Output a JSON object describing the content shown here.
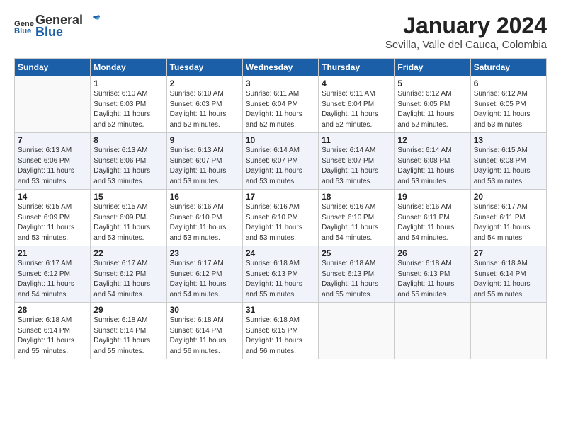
{
  "logo": {
    "general": "General",
    "blue": "Blue"
  },
  "title": "January 2024",
  "location": "Sevilla, Valle del Cauca, Colombia",
  "headers": [
    "Sunday",
    "Monday",
    "Tuesday",
    "Wednesday",
    "Thursday",
    "Friday",
    "Saturday"
  ],
  "weeks": [
    [
      {
        "day": "",
        "sunrise": "",
        "sunset": "",
        "daylight": ""
      },
      {
        "day": "1",
        "sunrise": "6:10 AM",
        "sunset": "6:03 PM",
        "daylight": "11 hours and 52 minutes."
      },
      {
        "day": "2",
        "sunrise": "6:10 AM",
        "sunset": "6:03 PM",
        "daylight": "11 hours and 52 minutes."
      },
      {
        "day": "3",
        "sunrise": "6:11 AM",
        "sunset": "6:04 PM",
        "daylight": "11 hours and 52 minutes."
      },
      {
        "day": "4",
        "sunrise": "6:11 AM",
        "sunset": "6:04 PM",
        "daylight": "11 hours and 52 minutes."
      },
      {
        "day": "5",
        "sunrise": "6:12 AM",
        "sunset": "6:05 PM",
        "daylight": "11 hours and 52 minutes."
      },
      {
        "day": "6",
        "sunrise": "6:12 AM",
        "sunset": "6:05 PM",
        "daylight": "11 hours and 53 minutes."
      }
    ],
    [
      {
        "day": "7",
        "sunrise": "6:13 AM",
        "sunset": "6:06 PM",
        "daylight": "11 hours and 53 minutes."
      },
      {
        "day": "8",
        "sunrise": "6:13 AM",
        "sunset": "6:06 PM",
        "daylight": "11 hours and 53 minutes."
      },
      {
        "day": "9",
        "sunrise": "6:13 AM",
        "sunset": "6:07 PM",
        "daylight": "11 hours and 53 minutes."
      },
      {
        "day": "10",
        "sunrise": "6:14 AM",
        "sunset": "6:07 PM",
        "daylight": "11 hours and 53 minutes."
      },
      {
        "day": "11",
        "sunrise": "6:14 AM",
        "sunset": "6:07 PM",
        "daylight": "11 hours and 53 minutes."
      },
      {
        "day": "12",
        "sunrise": "6:14 AM",
        "sunset": "6:08 PM",
        "daylight": "11 hours and 53 minutes."
      },
      {
        "day": "13",
        "sunrise": "6:15 AM",
        "sunset": "6:08 PM",
        "daylight": "11 hours and 53 minutes."
      }
    ],
    [
      {
        "day": "14",
        "sunrise": "6:15 AM",
        "sunset": "6:09 PM",
        "daylight": "11 hours and 53 minutes."
      },
      {
        "day": "15",
        "sunrise": "6:15 AM",
        "sunset": "6:09 PM",
        "daylight": "11 hours and 53 minutes."
      },
      {
        "day": "16",
        "sunrise": "6:16 AM",
        "sunset": "6:10 PM",
        "daylight": "11 hours and 53 minutes."
      },
      {
        "day": "17",
        "sunrise": "6:16 AM",
        "sunset": "6:10 PM",
        "daylight": "11 hours and 53 minutes."
      },
      {
        "day": "18",
        "sunrise": "6:16 AM",
        "sunset": "6:10 PM",
        "daylight": "11 hours and 54 minutes."
      },
      {
        "day": "19",
        "sunrise": "6:16 AM",
        "sunset": "6:11 PM",
        "daylight": "11 hours and 54 minutes."
      },
      {
        "day": "20",
        "sunrise": "6:17 AM",
        "sunset": "6:11 PM",
        "daylight": "11 hours and 54 minutes."
      }
    ],
    [
      {
        "day": "21",
        "sunrise": "6:17 AM",
        "sunset": "6:12 PM",
        "daylight": "11 hours and 54 minutes."
      },
      {
        "day": "22",
        "sunrise": "6:17 AM",
        "sunset": "6:12 PM",
        "daylight": "11 hours and 54 minutes."
      },
      {
        "day": "23",
        "sunrise": "6:17 AM",
        "sunset": "6:12 PM",
        "daylight": "11 hours and 54 minutes."
      },
      {
        "day": "24",
        "sunrise": "6:18 AM",
        "sunset": "6:13 PM",
        "daylight": "11 hours and 55 minutes."
      },
      {
        "day": "25",
        "sunrise": "6:18 AM",
        "sunset": "6:13 PM",
        "daylight": "11 hours and 55 minutes."
      },
      {
        "day": "26",
        "sunrise": "6:18 AM",
        "sunset": "6:13 PM",
        "daylight": "11 hours and 55 minutes."
      },
      {
        "day": "27",
        "sunrise": "6:18 AM",
        "sunset": "6:14 PM",
        "daylight": "11 hours and 55 minutes."
      }
    ],
    [
      {
        "day": "28",
        "sunrise": "6:18 AM",
        "sunset": "6:14 PM",
        "daylight": "11 hours and 55 minutes."
      },
      {
        "day": "29",
        "sunrise": "6:18 AM",
        "sunset": "6:14 PM",
        "daylight": "11 hours and 55 minutes."
      },
      {
        "day": "30",
        "sunrise": "6:18 AM",
        "sunset": "6:14 PM",
        "daylight": "11 hours and 56 minutes."
      },
      {
        "day": "31",
        "sunrise": "6:18 AM",
        "sunset": "6:15 PM",
        "daylight": "11 hours and 56 minutes."
      },
      {
        "day": "",
        "sunrise": "",
        "sunset": "",
        "daylight": ""
      },
      {
        "day": "",
        "sunrise": "",
        "sunset": "",
        "daylight": ""
      },
      {
        "day": "",
        "sunrise": "",
        "sunset": "",
        "daylight": ""
      }
    ]
  ]
}
